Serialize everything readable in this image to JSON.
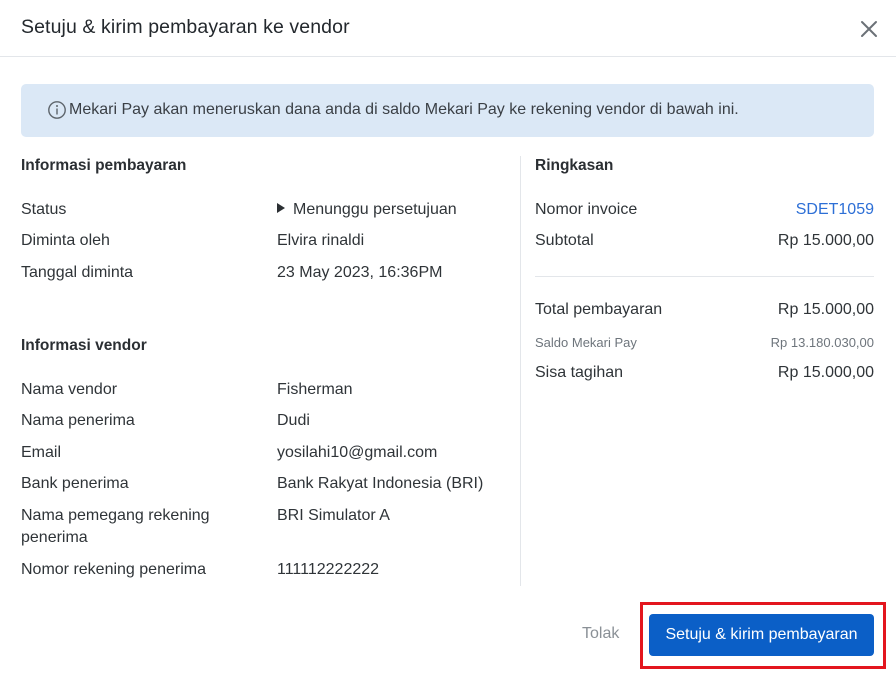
{
  "dialog": {
    "title": "Setuju & kirim pembayaran ke vendor",
    "close_icon": "close-icon"
  },
  "banner": {
    "icon": "info-icon",
    "text": "Mekari Pay akan meneruskan dana anda di saldo Mekari Pay ke rekening vendor di bawah ini."
  },
  "payment_info": {
    "title": "Informasi pembayaran",
    "rows": [
      {
        "label": "Status",
        "value": "Menunggu persetujuan"
      },
      {
        "label": "Diminta oleh",
        "value": "Elvira rinaldi"
      },
      {
        "label": "Tanggal diminta",
        "value": "23 May 2023, 16:36PM"
      }
    ]
  },
  "vendor_info": {
    "title": "Informasi vendor",
    "rows": [
      {
        "label": "Nama vendor",
        "value": "Fisherman"
      },
      {
        "label": "Nama penerima",
        "value": "Dudi"
      },
      {
        "label": "Email",
        "value": "yosilahi10@gmail.com"
      },
      {
        "label": "Bank penerima",
        "value": "Bank Rakyat Indonesia (BRI)"
      },
      {
        "label": "Nama pemegang rekening penerima",
        "value": "BRI Simulator A"
      },
      {
        "label": "Nomor rekening penerima",
        "value": "111112222222"
      }
    ]
  },
  "summary": {
    "title": "Ringkasan",
    "invoice_label": "Nomor invoice",
    "invoice_value": "SDET1059",
    "subtotal_label": "Subtotal",
    "subtotal_value": "Rp 15.000,00",
    "total_label": "Total pembayaran",
    "total_value": "Rp 15.000,00",
    "balance_label": "Saldo Mekari Pay",
    "balance_value": "Rp 13.180.030,00",
    "remaining_label": "Sisa tagihan",
    "remaining_value": "Rp 15.000,00"
  },
  "footer": {
    "reject_label": "Tolak",
    "confirm_label": "Setuju & kirim pembayaran"
  },
  "colors": {
    "primary": "#0b5fc7",
    "link": "#2d6fd6",
    "banner_bg": "#dbe8f6",
    "highlight": "#e3161e"
  }
}
